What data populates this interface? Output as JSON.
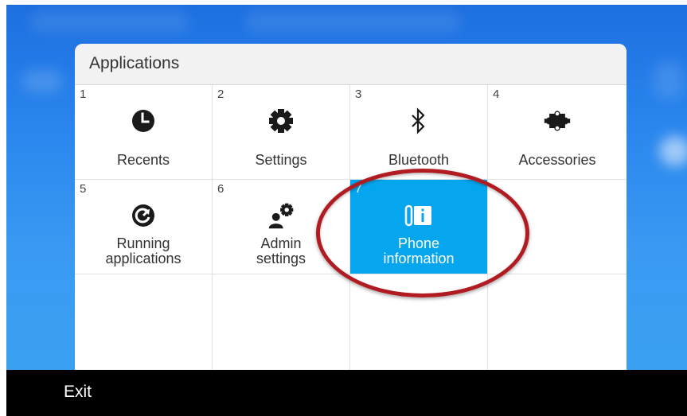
{
  "dialog": {
    "title": "Applications"
  },
  "apps": [
    {
      "number": "1",
      "label": "Recents",
      "icon": "clock-icon"
    },
    {
      "number": "2",
      "label": "Settings",
      "icon": "gear-icon"
    },
    {
      "number": "3",
      "label": "Bluetooth",
      "icon": "bluetooth-icon"
    },
    {
      "number": "4",
      "label": "Accessories",
      "icon": "puzzle-piece-icon"
    },
    {
      "number": "5",
      "label_line1": "Running",
      "label_line2": "applications",
      "icon": "refresh-icon"
    },
    {
      "number": "6",
      "label_line1": "Admin",
      "label_line2": "settings",
      "icon": "admin-gear-icon"
    },
    {
      "number": "7",
      "label_line1": "Phone",
      "label_line2": "information",
      "icon": "phone-info-icon",
      "selected": true
    }
  ],
  "footer": {
    "exit_label": "Exit"
  },
  "colors": {
    "selected_tile": "#05a6ee",
    "highlight_ring": "#b01c22",
    "background_blue": "#2a86ee",
    "footer": "#000000"
  }
}
